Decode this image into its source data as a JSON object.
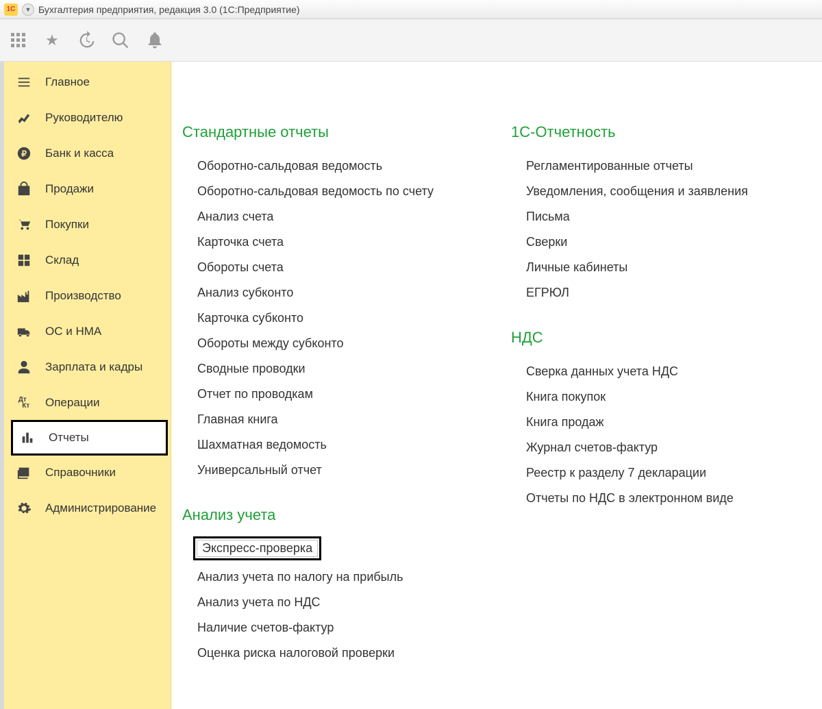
{
  "window": {
    "title": "Бухгалтерия предприятия, редакция 3.0  (1С:Предприятие)"
  },
  "sidebar": {
    "items": [
      {
        "label": "Главное",
        "icon": "menu"
      },
      {
        "label": "Руководителю",
        "icon": "trend"
      },
      {
        "label": "Банк и касса",
        "icon": "ruble"
      },
      {
        "label": "Продажи",
        "icon": "bag"
      },
      {
        "label": "Покупки",
        "icon": "cart"
      },
      {
        "label": "Склад",
        "icon": "blocks"
      },
      {
        "label": "Производство",
        "icon": "factory"
      },
      {
        "label": "ОС и НМА",
        "icon": "truck"
      },
      {
        "label": "Зарплата и кадры",
        "icon": "person"
      },
      {
        "label": "Операции",
        "icon": "dtk"
      },
      {
        "label": "Отчеты",
        "icon": "bars",
        "active": true
      },
      {
        "label": "Справочники",
        "icon": "folders"
      },
      {
        "label": "Администрирование",
        "icon": "gear"
      }
    ]
  },
  "sections": {
    "col1": [
      {
        "title": "Стандартные отчеты",
        "items": [
          "Оборотно-сальдовая ведомость",
          "Оборотно-сальдовая ведомость по счету",
          "Анализ счета",
          "Карточка счета",
          "Обороты счета",
          "Анализ субконто",
          "Карточка субконто",
          "Обороты между субконто",
          "Сводные проводки",
          "Отчет по проводкам",
          "Главная книга",
          "Шахматная ведомость",
          "Универсальный отчет"
        ]
      },
      {
        "title": "Анализ учета",
        "items": [
          "Экспресс-проверка",
          "Анализ учета по налогу на прибыль",
          "Анализ учета по НДС",
          "Наличие счетов-фактур",
          "Оценка риска налоговой проверки"
        ],
        "highlighted_index": 0
      }
    ],
    "col2": [
      {
        "title": "1С-Отчетность",
        "items": [
          "Регламентированные отчеты",
          "Уведомления, сообщения и заявления",
          "Письма",
          "Сверки",
          "Личные кабинеты",
          "ЕГРЮЛ"
        ]
      },
      {
        "title": "НДС",
        "items": [
          "Сверка данных учета НДС",
          "Книга покупок",
          "Книга продаж",
          "Журнал счетов-фактур",
          "Реестр к разделу 7 декларации",
          "Отчеты по НДС в электронном виде"
        ]
      }
    ]
  }
}
